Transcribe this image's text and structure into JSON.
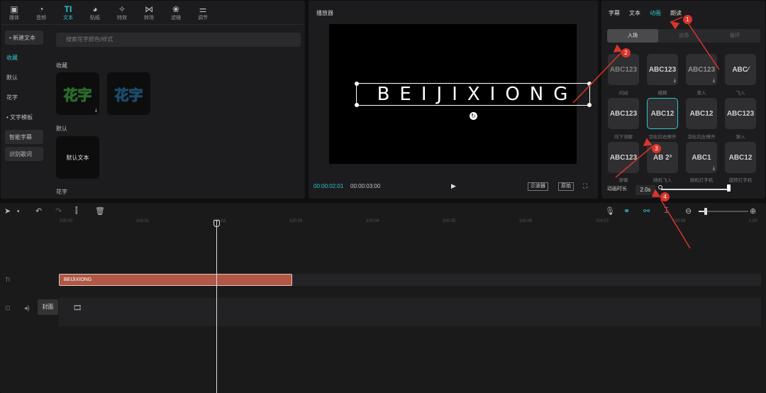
{
  "toolbar": {
    "items": [
      {
        "icon": "media-icon",
        "label": "媒体"
      },
      {
        "icon": "audio-icon",
        "label": "音频"
      },
      {
        "icon": "text-icon",
        "label": "文本"
      },
      {
        "icon": "sticker-icon",
        "label": "贴纸"
      },
      {
        "icon": "effects-icon",
        "label": "特效"
      },
      {
        "icon": "transition-icon",
        "label": "转场"
      },
      {
        "icon": "filter-icon",
        "label": "滤镜"
      },
      {
        "icon": "adjust-icon",
        "label": "调节"
      }
    ],
    "active": "文本"
  },
  "sidebar": {
    "items": [
      {
        "label": "• 新建文本"
      },
      {
        "label": "收藏"
      },
      {
        "label": "默认"
      },
      {
        "label": "花字"
      },
      {
        "label": "• 文字模板"
      },
      {
        "label": "智能字幕"
      },
      {
        "label": "识别歌词"
      }
    ]
  },
  "library": {
    "search_placeholder": "搜索花字颜色/样式",
    "section_favorites": "收藏",
    "card1_text": "花字",
    "card2_text": "花字",
    "section_default": "默认",
    "default_card_text": "默认文本",
    "section_huazi": "花字"
  },
  "player": {
    "title": "播放器",
    "canvas_text": "BEIJIXIONG",
    "current_time": "00:00:02:01",
    "total_time": "00:00:03:00",
    "btn_scope": "示波器",
    "btn_original": "原始"
  },
  "right_panel": {
    "tabs": [
      "字幕",
      "文本",
      "动画",
      "朗读"
    ],
    "active_tab": "动画",
    "subtabs": [
      "入场",
      "出场",
      "循环"
    ],
    "active_subtab": "入场",
    "animations": [
      {
        "text": "ABC123",
        "label": "闪动"
      },
      {
        "text": "ABC123",
        "label": "模糊"
      },
      {
        "text": "ABC123",
        "label": "渐入"
      },
      {
        "text": "ABC⁄",
        "label": "飞入"
      },
      {
        "text": "ABC123",
        "label": "向下溶解"
      },
      {
        "text": "ABC12",
        "label": "羽化向右擦开"
      },
      {
        "text": "ABC12",
        "label": "羽化向左擦开"
      },
      {
        "text": "ABC123",
        "label": "弹入"
      },
      {
        "text": "ABC123",
        "label": "弹簧"
      },
      {
        "text": "AB 2³",
        "label": "随机飞入"
      },
      {
        "text": "ABC1",
        "label": "随机打字机"
      },
      {
        "text": "ABC12",
        "label": "旋转打字机"
      }
    ],
    "duration_label": "动画时长",
    "duration_value": "2.0s"
  },
  "timeline": {
    "ruler": [
      "100:00",
      "100:01",
      "100:02",
      "100:03",
      "100:04",
      "100:05",
      "100:06",
      "100:07",
      "100:08",
      "1:00"
    ],
    "clip_label": "BEIJIXIONG",
    "cover_label": "封面"
  },
  "annotations": [
    "1",
    "2",
    "3",
    "4"
  ],
  "colors": {
    "accent": "#2ec4c8",
    "clip": "#b05745",
    "annotation": "#d9342b"
  }
}
